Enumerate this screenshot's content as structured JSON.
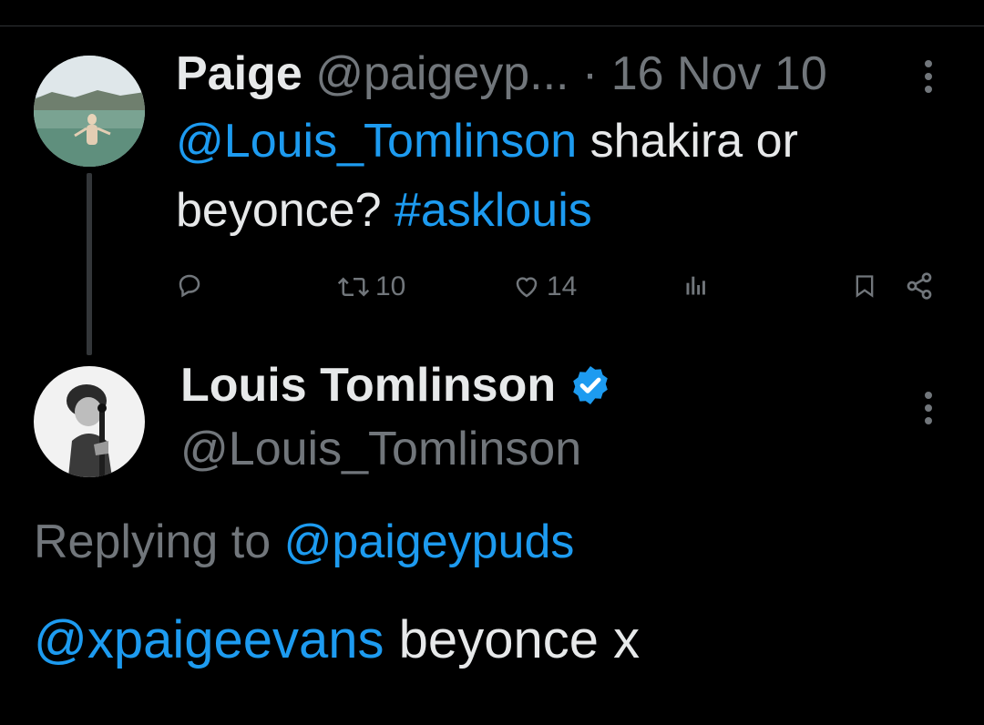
{
  "parent_tweet": {
    "display_name": "Paige",
    "handle": "@paigeyp...",
    "separator": "·",
    "date": "16 Nov 10",
    "mention": "@Louis_Tomlinson",
    "text_line1": " shakira or",
    "text_line2": "beyonce? ",
    "hashtag": "#asklouis",
    "actions": {
      "reply_icon": "reply-icon",
      "retweet_icon": "retweet-icon",
      "retweet_count": "10",
      "like_icon": "heart-icon",
      "like_count": "14",
      "views_icon": "views-icon",
      "bookmark_icon": "bookmark-icon",
      "share_icon": "share-icon"
    }
  },
  "reply_tweet": {
    "display_name": "Louis Tomlinson",
    "verified_icon": "verified-badge-icon",
    "handle": "@Louis_Tomlinson",
    "replying_prefix": "Replying to ",
    "replying_to": "@paigeypuds",
    "mention": "@xpaigeevans",
    "text": " beyonce x"
  },
  "colors": {
    "background": "#000000",
    "text": "#e7e9ea",
    "secondary": "#71767b",
    "accent": "#1d9bf0"
  }
}
